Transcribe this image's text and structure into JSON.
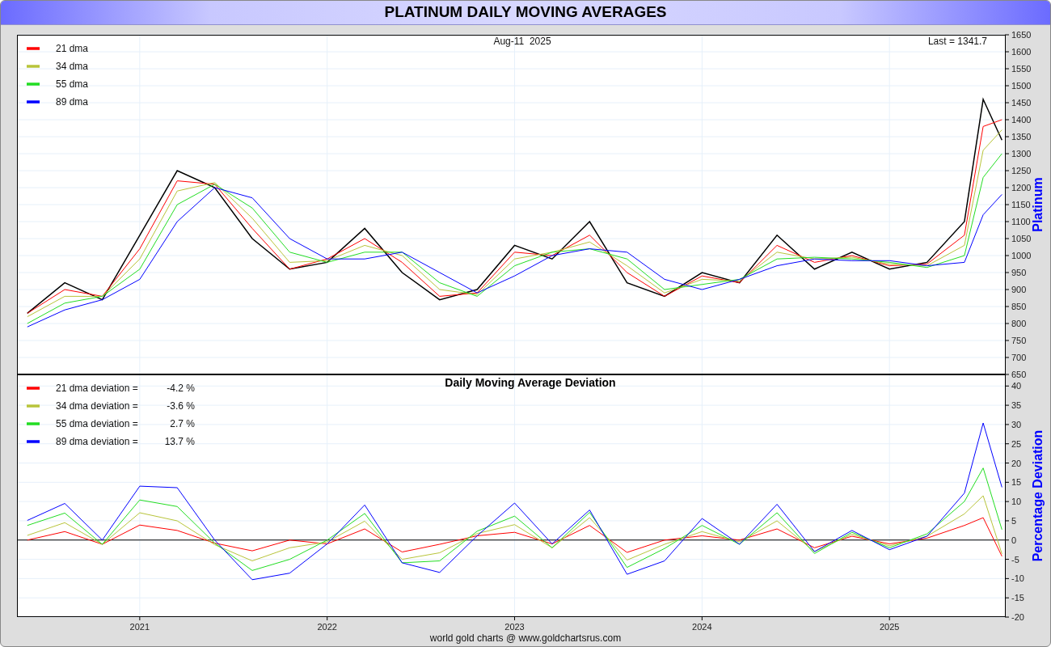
{
  "window": {
    "title": "PLATINUM DAILY MOVING AVERAGES"
  },
  "price_panel": {
    "date_label": "Aug-11  2025",
    "last_label": "Last = 1341.7",
    "chart_data": {
      "type": "line",
      "ylabel": "Platinum",
      "x": [
        2020.4,
        2020.6,
        2020.8,
        2021.0,
        2021.2,
        2021.4,
        2021.6,
        2021.8,
        2022.0,
        2022.2,
        2022.4,
        2022.6,
        2022.8,
        2023.0,
        2023.2,
        2023.4,
        2023.6,
        2023.8,
        2024.0,
        2024.2,
        2024.4,
        2024.6,
        2024.8,
        2025.0,
        2025.2,
        2025.4,
        2025.5,
        2025.6
      ],
      "series": [
        {
          "color": "#000000",
          "values": [
            830,
            920,
            870,
            1060,
            1250,
            1200,
            1050,
            960,
            980,
            1080,
            950,
            870,
            900,
            1030,
            990,
            1100,
            920,
            880,
            950,
            920,
            1060,
            960,
            1010,
            960,
            980,
            1100,
            1460,
            1340
          ]
        },
        {
          "name": "21 dma",
          "color": "#ff0000",
          "values": [
            830,
            900,
            880,
            1020,
            1220,
            1210,
            1080,
            960,
            990,
            1050,
            980,
            880,
            890,
            1010,
            1000,
            1060,
            950,
            880,
            940,
            920,
            1030,
            980,
            1000,
            970,
            975,
            1060,
            1380,
            1400
          ]
        },
        {
          "name": "34 dma",
          "color": "#b8c43a",
          "values": [
            820,
            880,
            880,
            990,
            1190,
            1215,
            1110,
            980,
            985,
            1030,
            1000,
            900,
            885,
            990,
            1010,
            1040,
            970,
            890,
            930,
            925,
            1010,
            990,
            995,
            975,
            970,
            1030,
            1310,
            1370
          ]
        },
        {
          "name": "55 dma",
          "color": "#22dd22",
          "values": [
            800,
            860,
            880,
            960,
            1150,
            1210,
            1140,
            1010,
            980,
            1010,
            1010,
            920,
            880,
            970,
            1010,
            1020,
            990,
            900,
            915,
            930,
            990,
            995,
            990,
            980,
            965,
            1000,
            1230,
            1300
          ]
        },
        {
          "name": "89 dma",
          "color": "#0000ff",
          "values": [
            790,
            840,
            870,
            930,
            1100,
            1200,
            1170,
            1050,
            990,
            990,
            1010,
            950,
            890,
            940,
            1000,
            1020,
            1010,
            930,
            900,
            930,
            970,
            990,
            985,
            985,
            970,
            980,
            1120,
            1180
          ]
        }
      ],
      "xlim": [
        2020.345,
        2025.616
      ],
      "ylim": [
        650,
        1650
      ],
      "grid": true,
      "legend": true,
      "yticks": [
        650,
        700,
        750,
        800,
        850,
        900,
        950,
        1000,
        1050,
        1100,
        1150,
        1200,
        1250,
        1300,
        1350,
        1400,
        1450,
        1500,
        1550,
        1600,
        1650
      ]
    }
  },
  "deviation_panel": {
    "legend_readings": [
      "-4.2 %",
      "-3.6 %",
      "2.7 %",
      "13.7 %"
    ],
    "chart_data": {
      "type": "line",
      "title": "Daily Moving Average Deviation",
      "ylabel": "Percentage Deviation",
      "x": [
        2020.4,
        2020.6,
        2020.8,
        2021.0,
        2021.2,
        2021.4,
        2021.6,
        2021.8,
        2022.0,
        2022.2,
        2022.4,
        2022.6,
        2022.8,
        2023.0,
        2023.2,
        2023.4,
        2023.6,
        2023.8,
        2024.0,
        2024.2,
        2024.4,
        2024.6,
        2024.8,
        2025.0,
        2025.2,
        2025.4,
        2025.5,
        2025.6
      ],
      "series": [
        {
          "name": "21 dma deviation =",
          "color": "#ff0000",
          "values": [
            0,
            2.2,
            -1.1,
            3.9,
            2.5,
            -0.8,
            -2.8,
            0,
            -1,
            2.9,
            -3.1,
            -1.1,
            1.1,
            2,
            -1,
            3.8,
            -3.2,
            0,
            1.1,
            0,
            2.9,
            -2,
            1,
            -1,
            0.5,
            3.8,
            5.8,
            -4.2
          ]
        },
        {
          "name": "34 dma deviation =",
          "color": "#b8c43a",
          "values": [
            1.2,
            4.5,
            -1.1,
            7.1,
            5,
            -1.2,
            -5.4,
            -2,
            -0.5,
            4.9,
            -5,
            -3.3,
            1.7,
            4,
            -2,
            5.8,
            -5.2,
            -1.1,
            2.2,
            -0.5,
            5,
            -3,
            1.5,
            -1.5,
            1,
            6.8,
            11.5,
            -3.6
          ]
        },
        {
          "name": "55 dma deviation =",
          "color": "#22dd22",
          "values": [
            3.8,
            7,
            -1.1,
            10.4,
            8.7,
            -0.8,
            -7.9,
            -5,
            0,
            6.9,
            -5.9,
            -5.4,
            2.3,
            6.2,
            -2,
            7.2,
            -7.1,
            -2.2,
            3.8,
            -1.1,
            7.1,
            -3.5,
            2,
            -2,
            1.6,
            10,
            18.7,
            2.7
          ]
        },
        {
          "name": "89 dma deviation =",
          "color": "#0000ff",
          "values": [
            5.1,
            9.5,
            0,
            14,
            13.6,
            0,
            -10.3,
            -8.6,
            -1,
            9.1,
            -5.9,
            -8.4,
            1.1,
            9.6,
            -1,
            7.8,
            -8.9,
            -5.4,
            5.6,
            -1.1,
            9.3,
            -3,
            2.5,
            -2.5,
            1,
            12.2,
            30.4,
            13.7
          ]
        }
      ],
      "xlim": [
        2020.345,
        2025.616
      ],
      "ylim": [
        -20,
        43
      ],
      "grid": true,
      "legend": true,
      "xticks": [
        {
          "value": 2021,
          "label": "2021"
        },
        {
          "value": 2022,
          "label": "2022"
        },
        {
          "value": 2023,
          "label": "2023"
        },
        {
          "value": 2024,
          "label": "2024"
        },
        {
          "value": 2025,
          "label": "2025"
        }
      ],
      "yticks": [
        -20,
        -15,
        -10,
        -5,
        0,
        5,
        10,
        15,
        20,
        25,
        30,
        35,
        40
      ]
    }
  },
  "footer": {
    "text": "world gold charts @ www.goldchartsrus.com"
  }
}
